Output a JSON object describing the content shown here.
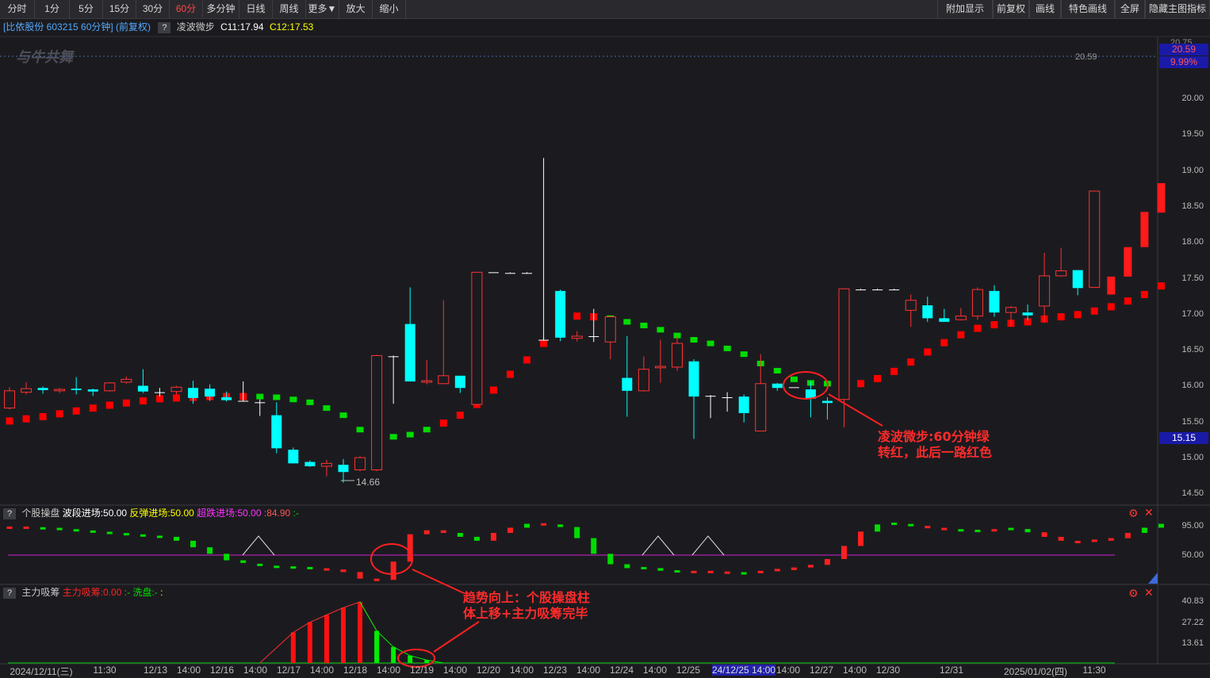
{
  "toolbar": {
    "left": [
      "分时",
      "1分",
      "5分",
      "15分",
      "30分",
      "60分",
      "多分钟",
      "日线",
      "周线",
      "更多▼",
      "放大",
      "缩小"
    ],
    "active": "60分",
    "right": [
      "附加显示",
      "前复权",
      "画线",
      "特色画线",
      "全屏",
      "隐藏主图指标"
    ]
  },
  "header": {
    "stock": "[比依股份 603215 60分钟] (前复权)",
    "indicator": "凌波微步",
    "c1": "C11:17.94",
    "c2": "C12:17.53"
  },
  "logo": "与牛共舞",
  "price_axis": {
    "ticks": [
      "20.00",
      "19.50",
      "19.00",
      "18.50",
      "18.00",
      "17.50",
      "17.00",
      "16.50",
      "16.00",
      "15.50",
      "15.00",
      "14.50"
    ],
    "top_partial": "20.75",
    "limit_price": "20.59",
    "limit_pct": "9.99%",
    "current": "15.15",
    "limit_marker": "20.59"
  },
  "low_marker": "14.66",
  "panel2": {
    "name": "个股操盘",
    "l1": "波段进场:50.00",
    "l2": "反弹进场:50.00",
    "l3": "超跌进场:50.00",
    "l4": ":84.90",
    "l5": ":-",
    "ticks": [
      "95.00",
      "50.00"
    ]
  },
  "panel3": {
    "name": "主力吸筹",
    "l1": "主力吸筹:0.00",
    "l2": ":-",
    "l3": "洗盘:-",
    "l4": ":",
    "ticks": [
      "40.83",
      "27.22",
      "13.61"
    ]
  },
  "annotations": {
    "a1_line1": "凌波微步:60分钟绿",
    "a1_line2": "转红，此后一路红色",
    "a2_line1": "趋势向上：个股操盘柱",
    "a2_line2": "体上移+主力吸筹完毕"
  },
  "xaxis": [
    {
      "label": "2024/12/11(三)"
    },
    {
      "label": "11:30"
    },
    {
      "label": "12/13"
    },
    {
      "label": "14:00"
    },
    {
      "label": "12/16"
    },
    {
      "label": "14:00"
    },
    {
      "label": "12/17"
    },
    {
      "label": "14:00"
    },
    {
      "label": "12/18"
    },
    {
      "label": "14:00"
    },
    {
      "label": "12/19"
    },
    {
      "label": "14:00"
    },
    {
      "label": "12/20"
    },
    {
      "label": "14:00"
    },
    {
      "label": "12/23"
    },
    {
      "label": "14:00"
    },
    {
      "label": "12/24"
    },
    {
      "label": "14:00"
    },
    {
      "label": "12/25"
    },
    {
      "label": "24/12/25 14:00"
    },
    {
      "label": "14:00"
    },
    {
      "label": "12/27"
    },
    {
      "label": "14:00"
    },
    {
      "label": "12/30"
    },
    {
      "label": "12/31"
    },
    {
      "label": "2025/01/02(四)"
    },
    {
      "label": "11:30"
    }
  ],
  "colors": {
    "up": "#ff3232",
    "down": "#00ffff",
    "ma_up": "#ff0000",
    "ma_down": "#00dd00",
    "accent": "#ff4444"
  },
  "chart_data": {
    "type": "candlestick",
    "ylim": [
      14.4,
      20.8
    ],
    "candles": [
      {
        "o": 15.7,
        "h": 15.99,
        "l": 15.68,
        "c": 15.94
      },
      {
        "o": 15.92,
        "h": 16.06,
        "l": 15.89,
        "c": 15.97
      },
      {
        "o": 15.98,
        "h": 16.0,
        "l": 15.9,
        "c": 15.95
      },
      {
        "o": 15.94,
        "h": 15.98,
        "l": 15.91,
        "c": 15.96
      },
      {
        "o": 15.97,
        "h": 16.13,
        "l": 15.89,
        "c": 15.95
      },
      {
        "o": 15.96,
        "h": 15.97,
        "l": 15.87,
        "c": 15.93
      },
      {
        "o": 15.94,
        "h": 16.06,
        "l": 15.93,
        "c": 16.05
      },
      {
        "o": 16.06,
        "h": 16.14,
        "l": 16.04,
        "c": 16.1
      },
      {
        "o": 16.01,
        "h": 16.24,
        "l": 15.91,
        "c": 15.93
      },
      {
        "o": 15.91,
        "h": 15.98,
        "l": 15.86,
        "c": 15.92
      },
      {
        "o": 15.93,
        "h": 16.01,
        "l": 15.89,
        "c": 15.99
      },
      {
        "o": 15.98,
        "h": 16.08,
        "l": 15.76,
        "c": 15.84
      },
      {
        "o": 15.97,
        "h": 16.03,
        "l": 15.8,
        "c": 15.86
      },
      {
        "o": 15.85,
        "h": 15.93,
        "l": 15.79,
        "c": 15.81
      },
      {
        "o": 15.8,
        "h": 16.07,
        "l": 15.79,
        "c": 15.79
      },
      {
        "o": 15.78,
        "h": 15.82,
        "l": 15.59,
        "c": 15.78
      },
      {
        "o": 15.6,
        "h": 15.78,
        "l": 15.07,
        "c": 15.14
      },
      {
        "o": 15.12,
        "h": 15.15,
        "l": 14.93,
        "c": 14.93
      },
      {
        "o": 14.95,
        "h": 14.97,
        "l": 14.88,
        "c": 14.89
      },
      {
        "o": 14.89,
        "h": 14.98,
        "l": 14.75,
        "c": 14.93
      },
      {
        "o": 14.91,
        "h": 14.99,
        "l": 14.66,
        "c": 14.81
      },
      {
        "o": 14.84,
        "h": 15.03,
        "l": 14.82,
        "c": 15.01
      },
      {
        "o": 14.84,
        "h": 16.44,
        "l": 14.82,
        "c": 16.43
      },
      {
        "o": 16.42,
        "h": 16.43,
        "l": 15.76,
        "c": 16.42
      },
      {
        "o": 16.87,
        "h": 17.38,
        "l": 16.07,
        "c": 16.07
      },
      {
        "o": 16.06,
        "h": 16.37,
        "l": 16.03,
        "c": 16.08
      },
      {
        "o": 16.04,
        "h": 17.2,
        "l": 16.03,
        "c": 16.15
      },
      {
        "o": 16.15,
        "h": 16.15,
        "l": 15.91,
        "c": 15.98
      },
      {
        "o": 15.75,
        "h": 17.59,
        "l": 15.74,
        "c": 17.59
      },
      {
        "o": 17.59,
        "h": 17.59,
        "l": 17.59,
        "c": 17.59
      },
      {
        "o": 17.58,
        "h": 17.59,
        "l": 17.58,
        "c": 17.58
      },
      {
        "o": 17.57,
        "h": 17.59,
        "l": 17.57,
        "c": 17.58
      },
      {
        "o": 16.65,
        "h": 19.18,
        "l": 16.64,
        "c": 16.64
      },
      {
        "o": 17.33,
        "h": 17.35,
        "l": 16.63,
        "c": 16.68
      },
      {
        "o": 16.67,
        "h": 16.77,
        "l": 16.63,
        "c": 16.7
      },
      {
        "o": 16.69,
        "h": 17.08,
        "l": 16.62,
        "c": 16.7
      },
      {
        "o": 16.62,
        "h": 16.97,
        "l": 16.38,
        "c": 16.97
      },
      {
        "o": 16.12,
        "h": 16.7,
        "l": 15.58,
        "c": 15.94
      },
      {
        "o": 15.94,
        "h": 16.42,
        "l": 15.93,
        "c": 16.24
      },
      {
        "o": 16.26,
        "h": 16.65,
        "l": 16.05,
        "c": 16.28
      },
      {
        "o": 16.27,
        "h": 16.7,
        "l": 16.22,
        "c": 16.6
      },
      {
        "o": 16.35,
        "h": 16.38,
        "l": 15.27,
        "c": 15.86
      },
      {
        "o": 15.86,
        "h": 15.88,
        "l": 15.56,
        "c": 15.87
      },
      {
        "o": 15.85,
        "h": 15.92,
        "l": 15.65,
        "c": 15.85
      },
      {
        "o": 15.86,
        "h": 15.89,
        "l": 15.5,
        "c": 15.63
      },
      {
        "o": 15.38,
        "h": 16.45,
        "l": 15.38,
        "c": 16.04
      },
      {
        "o": 16.04,
        "h": 16.05,
        "l": 15.94,
        "c": 15.98
      },
      {
        "o": 15.99,
        "h": 15.99,
        "l": 15.99,
        "c": 15.99
      },
      {
        "o": 15.96,
        "h": 16.07,
        "l": 15.57,
        "c": 15.83
      },
      {
        "o": 15.8,
        "h": 15.85,
        "l": 15.54,
        "c": 15.77
      },
      {
        "o": 15.82,
        "h": 17.36,
        "l": 15.43,
        "c": 17.36
      },
      {
        "o": 17.35,
        "h": 17.36,
        "l": 17.35,
        "c": 17.35
      },
      {
        "o": 17.35,
        "h": 17.36,
        "l": 17.34,
        "c": 17.35
      },
      {
        "o": 17.35,
        "h": 17.36,
        "l": 17.34,
        "c": 17.35
      },
      {
        "o": 17.06,
        "h": 17.28,
        "l": 16.83,
        "c": 17.2
      },
      {
        "o": 17.13,
        "h": 17.25,
        "l": 16.9,
        "c": 16.95
      },
      {
        "o": 16.95,
        "h": 17.08,
        "l": 16.9,
        "c": 16.9
      },
      {
        "o": 16.93,
        "h": 17.09,
        "l": 16.92,
        "c": 16.98
      },
      {
        "o": 16.98,
        "h": 17.38,
        "l": 16.93,
        "c": 17.35
      },
      {
        "o": 17.33,
        "h": 17.41,
        "l": 16.97,
        "c": 17.03
      },
      {
        "o": 17.03,
        "h": 17.12,
        "l": 16.84,
        "c": 17.1
      },
      {
        "o": 17.03,
        "h": 17.14,
        "l": 16.92,
        "c": 16.99
      },
      {
        "o": 17.12,
        "h": 17.86,
        "l": 16.89,
        "c": 17.54
      },
      {
        "o": 17.54,
        "h": 17.93,
        "l": 17.53,
        "c": 17.61
      },
      {
        "o": 17.62,
        "h": 17.62,
        "l": 17.27,
        "c": 17.37
      },
      {
        "o": 17.38,
        "h": 18.72,
        "l": 17.38,
        "c": 18.72
      }
    ],
    "big_bars": [
      {
        "i": 66,
        "o": 17.28,
        "c": 17.53
      },
      {
        "i": 67,
        "o": 17.53,
        "c": 17.94
      },
      {
        "i": 68,
        "o": 17.94,
        "c": 18.43
      },
      {
        "i": 69,
        "o": 18.42,
        "c": 18.83
      }
    ],
    "ma": [
      15.52,
      15.55,
      15.58,
      15.62,
      15.66,
      15.7,
      15.74,
      15.77,
      15.8,
      15.83,
      15.84,
      15.85,
      15.86,
      15.86,
      15.86,
      15.86,
      15.85,
      15.82,
      15.78,
      15.7,
      15.6,
      15.4,
      15.3,
      15.3,
      15.33,
      15.4,
      15.49,
      15.6,
      15.75,
      15.95,
      16.17,
      16.37,
      16.6,
      16.81,
      16.98,
      16.97,
      16.95,
      16.9,
      16.85,
      16.79,
      16.71,
      16.65,
      16.6,
      16.53,
      16.45,
      16.32,
      16.22,
      16.1,
      16.05,
      16.04,
      16.03,
      16.04,
      16.11,
      16.21,
      16.34,
      16.48,
      16.61,
      16.72,
      16.81,
      16.86,
      16.88,
      16.9,
      16.94,
      16.97,
      17.0,
      17.05,
      17.11,
      17.19,
      17.28,
      17.4
    ],
    "ma_color": [
      "r",
      "r",
      "r",
      "r",
      "r",
      "r",
      "r",
      "r",
      "r",
      "r",
      "r",
      "r",
      "r",
      "r",
      "r",
      "g",
      "g",
      "g",
      "g",
      "g",
      "g",
      "g",
      "g",
      "g",
      "g",
      "g",
      "r",
      "r",
      "r",
      "r",
      "r",
      "r",
      "r",
      "r",
      "r",
      "r",
      "g",
      "g",
      "g",
      "g",
      "g",
      "g",
      "g",
      "g",
      "g",
      "g",
      "g",
      "g",
      "g",
      "g",
      "g",
      "r",
      "r",
      "r",
      "r",
      "r",
      "r",
      "r",
      "r",
      "r",
      "r",
      "r",
      "r",
      "r",
      "r",
      "r",
      "r",
      "r",
      "r",
      "r"
    ],
    "op_values": [
      92,
      92,
      91,
      90,
      88,
      86,
      84,
      82,
      80,
      78,
      72,
      62,
      52,
      42,
      38,
      35,
      32,
      31,
      30,
      28,
      24,
      14,
      12,
      40,
      82,
      88,
      84,
      78,
      72,
      84,
      92,
      98,
      97,
      93,
      76,
      52,
      36,
      30,
      30,
      26,
      25,
      24,
      24,
      23,
      22,
      24,
      27,
      31,
      35,
      44,
      64,
      86,
      97,
      98,
      96,
      93,
      90,
      88,
      87,
      88,
      90,
      85,
      78,
      72,
      70,
      72,
      76,
      84,
      92,
      98
    ],
    "op_color": [
      "r",
      "r",
      "g",
      "g",
      "g",
      "g",
      "g",
      "g",
      "g",
      "g",
      "g",
      "g",
      "g",
      "g",
      "g",
      "g",
      "g",
      "g",
      "g",
      "r",
      "r",
      "r",
      "r",
      "r",
      "r",
      "r",
      "r",
      "g",
      "g",
      "r",
      "r",
      "g",
      "r",
      "g",
      "g",
      "g",
      "g",
      "g",
      "g",
      "g",
      "g",
      "r",
      "r",
      "r",
      "g",
      "r",
      "r",
      "r",
      "r",
      "r",
      "r",
      "r",
      "g",
      "g",
      "g",
      "r",
      "r",
      "g",
      "g",
      "r",
      "g",
      "g",
      "r",
      "r",
      "r",
      "r",
      "r",
      "r",
      "g",
      "g"
    ],
    "xi_values": [
      0,
      0,
      0,
      0,
      0,
      0,
      0,
      0,
      0,
      0,
      0,
      0,
      0,
      0,
      0,
      0,
      0,
      21,
      28,
      33,
      38,
      42,
      0,
      0,
      0,
      0,
      0,
      0,
      0,
      0,
      0,
      0,
      0,
      0,
      0,
      0,
      0,
      0,
      0,
      0,
      0,
      0,
      0,
      0,
      0,
      0,
      0,
      0,
      0,
      0,
      0,
      0,
      0,
      0,
      0,
      0,
      0,
      0,
      0,
      0,
      0,
      0,
      0,
      0,
      0,
      0,
      0,
      0,
      0,
      0
    ],
    "xi_green": [
      0,
      0,
      0,
      0,
      0,
      0,
      0,
      0,
      0,
      0,
      0,
      0,
      0,
      0,
      0,
      0,
      0,
      0,
      0,
      0,
      0,
      0,
      22,
      11,
      5,
      2,
      0,
      0,
      0,
      0,
      0,
      0,
      0,
      0,
      0,
      0,
      0,
      0,
      0,
      0,
      0,
      0,
      0,
      0,
      0,
      0,
      0,
      0,
      0,
      0,
      0,
      0,
      0,
      0,
      0,
      0,
      0,
      0,
      0,
      0,
      0,
      0,
      0,
      0,
      0,
      0,
      0,
      0,
      0,
      0
    ]
  }
}
